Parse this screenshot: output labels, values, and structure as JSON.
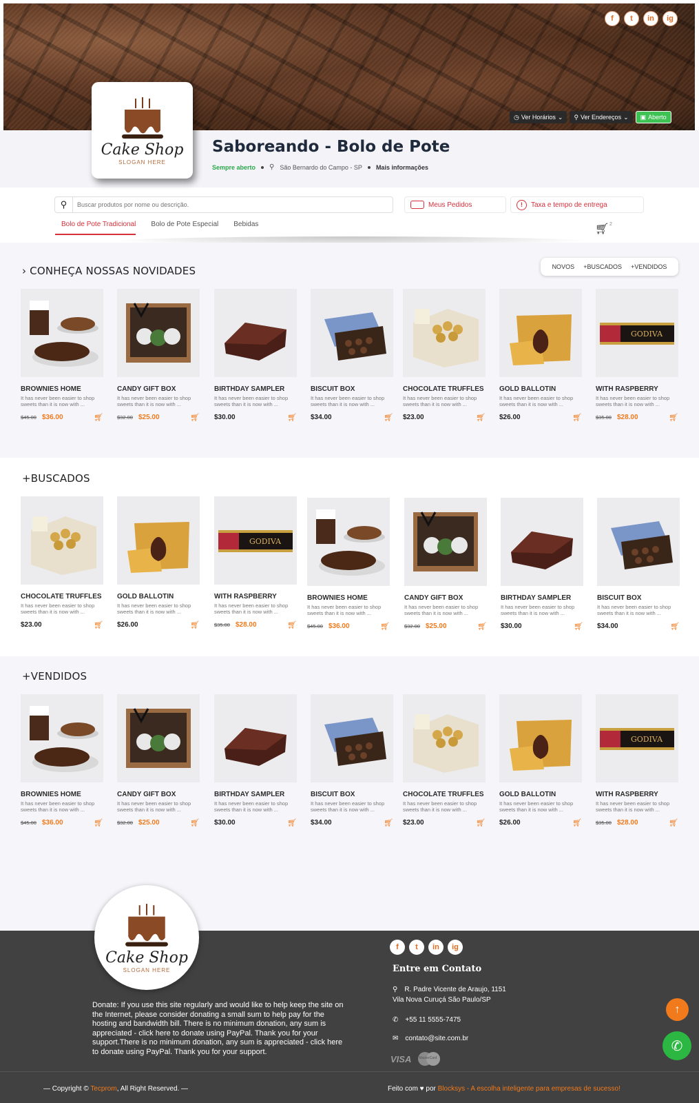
{
  "header": {
    "social": [
      "f",
      "t",
      "in",
      "ig"
    ],
    "hours_label": "Ver Horários",
    "addresses_label": "Ver Endereços",
    "status_label": "Aberto"
  },
  "brand": {
    "logo_title": "Cake Shop",
    "logo_slogan": "SLOGAN HERE"
  },
  "shop": {
    "title": "Saboreando - Bolo de Pote",
    "always_open": "Sempre aberto",
    "location": "São Bernardo do Campo - SP",
    "more_info": "Mais informações"
  },
  "search": {
    "placeholder": "Buscar produtos por nome ou descrição."
  },
  "actions": {
    "orders_label": "Meus Pedidos",
    "delivery_label": "Taxa e tempo de entrega"
  },
  "tabs": [
    "Bolo de Pote Tradicional",
    "Bolo de Pote Especial",
    "Bebidas"
  ],
  "cart": {
    "count": "2"
  },
  "sections": {
    "news_title": "› CONHEÇA NOSSAS NOVIDADES",
    "filters": [
      "NOVOS",
      "+BUSCADOS",
      "+VENDIDOS"
    ],
    "searched_title": "+BUSCADOS",
    "sold_title": "+VENDIDOS"
  },
  "products": {
    "news": [
      {
        "name": "BROWNIES HOME",
        "desc": "It has never been easier to shop sweets than it is now with ...",
        "old": "$45.00",
        "price": "$36.00",
        "art": "brownies"
      },
      {
        "name": "CANDY GIFT BOX",
        "desc": "It has never been easier to shop sweets than it is now with ...",
        "old": "$32.00",
        "price": "$25.00",
        "art": "giftbox"
      },
      {
        "name": "BIRTHDAY SAMPLER",
        "desc": "It has never been easier to shop sweets than it is now with ...",
        "old": "",
        "price": "$30.00",
        "art": "sampler"
      },
      {
        "name": "BISCUIT BOX",
        "desc": "It has never been easier to shop sweets than it is now with ...",
        "old": "",
        "price": "$34.00",
        "art": "biscuit"
      },
      {
        "name": "CHOCOLATE TRUFFLES",
        "desc": "It has never been easier to shop sweets than it is now with ...",
        "old": "",
        "price": "$23.00",
        "art": "truffles"
      },
      {
        "name": "GOLD BALLOTIN",
        "desc": "It has never been easier to shop sweets than it is now with ...",
        "old": "",
        "price": "$26.00",
        "art": "ballotin"
      },
      {
        "name": "WITH RASPBERRY",
        "desc": "It has never been easier to shop sweets than it is now with ...",
        "old": "$35.00",
        "price": "$28.00",
        "art": "godiva"
      }
    ],
    "searched": [
      {
        "name": "CHOCOLATE TRUFFLES",
        "desc": "It has never been easier to shop sweets than it is now with ...",
        "old": "",
        "price": "$23.00",
        "art": "truffles"
      },
      {
        "name": "GOLD BALLOTIN",
        "desc": "It has never been easier to shop sweets than it is now with ...",
        "old": "",
        "price": "$26.00",
        "art": "ballotin"
      },
      {
        "name": "WITH RASPBERRY",
        "desc": "It has never been easier to shop sweets than it is now with ...",
        "old": "$35.00",
        "price": "$28.00",
        "art": "godiva"
      },
      {
        "name": "BROWNIES HOME",
        "desc": "It has never been easier to shop sweets than it is now with ...",
        "old": "$45.00",
        "price": "$36.00",
        "art": "brownies"
      },
      {
        "name": "CANDY GIFT BOX",
        "desc": "It has never been easier to shop sweets than it is now with ...",
        "old": "$32.00",
        "price": "$25.00",
        "art": "giftbox"
      },
      {
        "name": "BIRTHDAY SAMPLER",
        "desc": "It has never been easier to shop sweets than it is now with ...",
        "old": "",
        "price": "$30.00",
        "art": "sampler"
      },
      {
        "name": "BISCUIT BOX",
        "desc": "It has never been easier to shop sweets than it is now with ...",
        "old": "",
        "price": "$34.00",
        "art": "biscuit"
      }
    ],
    "sold": [
      {
        "name": "BROWNIES HOME",
        "desc": "It has never been easier to shop sweets than it is now with ...",
        "old": "$45.00",
        "price": "$36.00",
        "art": "brownies"
      },
      {
        "name": "CANDY GIFT BOX",
        "desc": "It has never been easier to shop sweets than it is now with ...",
        "old": "$32.00",
        "price": "$25.00",
        "art": "giftbox"
      },
      {
        "name": "BIRTHDAY SAMPLER",
        "desc": "It has never been easier to shop sweets than it is now with ...",
        "old": "",
        "price": "$30.00",
        "art": "sampler"
      },
      {
        "name": "BISCUIT BOX",
        "desc": "It has never been easier to shop sweets than it is now with ...",
        "old": "",
        "price": "$34.00",
        "art": "biscuit"
      },
      {
        "name": "CHOCOLATE TRUFFLES",
        "desc": "It has never been easier to shop sweets than it is now with ...",
        "old": "",
        "price": "$23.00",
        "art": "truffles"
      },
      {
        "name": "GOLD BALLOTIN",
        "desc": "It has never been easier to shop sweets than it is now with ...",
        "old": "",
        "price": "$26.00",
        "art": "ballotin"
      },
      {
        "name": "WITH RASPBERRY",
        "desc": "It has never been easier to shop sweets than it is now with ...",
        "old": "$35.00",
        "price": "$28.00",
        "art": "godiva"
      }
    ]
  },
  "footer": {
    "donate": "Donate: If you use this site regularly and would like to help keep the site on the Internet, please consider donating a small sum to help pay for the hosting and bandwidth bill. There is no minimum donation, any sum is appreciated - click here to donate using PayPal. Thank you for your support.There is no minimum donation, any sum is appreciated - click here to donate using PayPal. Thank you for your support.",
    "contact_title": "Entre em Contato",
    "address_line1": "R. Padre Vicente de Araujo, 1151",
    "address_line2": "Vila Nova Curuçá São Paulo/SP",
    "phone": "+55 11 5555-7475",
    "email": "contato@site.com.br",
    "payment_visa": "VISA",
    "payment_mc": "MasterCard",
    "copy_pre": "— Copyright © ",
    "copy_brand": "Tecprom",
    "copy_post": ", All Right Reserved. —",
    "made_pre": "Feito com ♥ por ",
    "made_link": "Blocksys - A escolha inteligente para empresas de sucesso!"
  },
  "colors": {
    "accent": "#f07a1c",
    "red": "#d6303a",
    "green": "#2bb741",
    "footer_bg": "#414141"
  }
}
